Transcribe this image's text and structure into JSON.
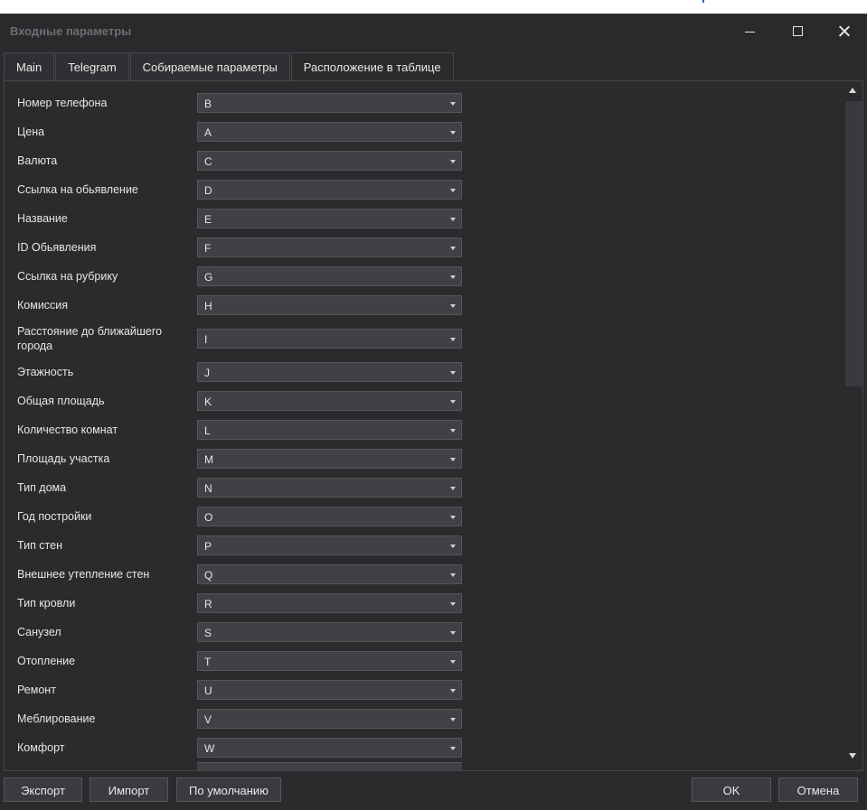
{
  "window": {
    "title": "Входные параметры",
    "controls": {
      "minimize": "minimize-icon",
      "maximize": "maximize-icon",
      "close": "close-icon"
    }
  },
  "tabs": [
    {
      "label": "Main",
      "active": false
    },
    {
      "label": "Telegram",
      "active": false
    },
    {
      "label": "Собираемые параметры",
      "active": false
    },
    {
      "label": "Расположение в таблице",
      "active": true
    }
  ],
  "rows": [
    {
      "label": "Номер телефона",
      "value": "B"
    },
    {
      "label": "Цена",
      "value": "A"
    },
    {
      "label": "Валюта",
      "value": "C"
    },
    {
      "label": "Ссылка на обьявление",
      "value": "D"
    },
    {
      "label": "Название",
      "value": "E"
    },
    {
      "label": "ID Обьявления",
      "value": "F"
    },
    {
      "label": "Ссылка на рубрику",
      "value": "G"
    },
    {
      "label": "Комиссия",
      "value": "H"
    },
    {
      "label": "Расстояние до ближайшего города",
      "value": "I"
    },
    {
      "label": "Этажность",
      "value": "J"
    },
    {
      "label": "Общая площадь",
      "value": "K"
    },
    {
      "label": "Количество комнат",
      "value": "L"
    },
    {
      "label": "Площадь участка",
      "value": "M"
    },
    {
      "label": "Тип дома",
      "value": "N"
    },
    {
      "label": "Год постройки",
      "value": "O"
    },
    {
      "label": "Тип стен",
      "value": "P"
    },
    {
      "label": "Внешнее утепление стен",
      "value": "Q"
    },
    {
      "label": "Тип кровли",
      "value": "R"
    },
    {
      "label": "Санузел",
      "value": "S"
    },
    {
      "label": "Отопление",
      "value": "T"
    },
    {
      "label": "Ремонт",
      "value": "U"
    },
    {
      "label": "Меблирование",
      "value": "V"
    },
    {
      "label": "Комфорт",
      "value": "W"
    }
  ],
  "footer": {
    "export": "Экспорт",
    "import": "Импорт",
    "defaults": "По умолчанию",
    "ok": "OK",
    "cancel": "Отмена"
  }
}
